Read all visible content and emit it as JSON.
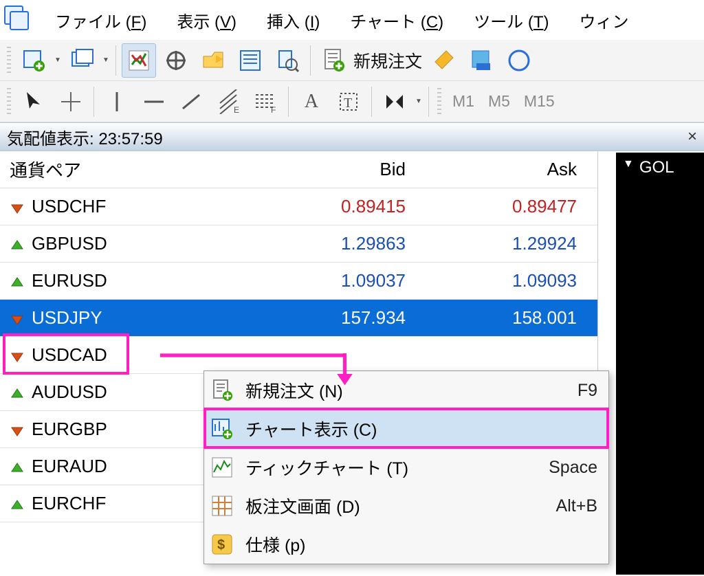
{
  "menu": {
    "items": [
      {
        "label": "ファイル",
        "key": "F"
      },
      {
        "label": "表示",
        "key": "V"
      },
      {
        "label": "挿入",
        "key": "I"
      },
      {
        "label": "チャート",
        "key": "C"
      },
      {
        "label": "ツール",
        "key": "T"
      },
      {
        "label": "ウィン",
        "key": ""
      }
    ]
  },
  "toolbar1": {
    "new_order_label": "新規注文"
  },
  "toolbar2": {
    "timeframes": [
      "M1",
      "M5",
      "M15"
    ]
  },
  "market_watch": {
    "title": "気配値表示: 23:57:59",
    "headers": {
      "symbol": "通貨ペア",
      "bid": "Bid",
      "ask": "Ask"
    },
    "rows": [
      {
        "symbol": "USDCHF",
        "bid": "0.89415",
        "ask": "0.89477",
        "dir": "down",
        "color": "down"
      },
      {
        "symbol": "GBPUSD",
        "bid": "1.29863",
        "ask": "1.29924",
        "dir": "up",
        "color": "up"
      },
      {
        "symbol": "EURUSD",
        "bid": "1.09037",
        "ask": "1.09093",
        "dir": "up",
        "color": "up"
      },
      {
        "symbol": "USDJPY",
        "bid": "157.934",
        "ask": "158.001",
        "dir": "down",
        "color": "up",
        "selected": true
      },
      {
        "symbol": "USDCAD",
        "bid": "",
        "ask": "",
        "dir": "down"
      },
      {
        "symbol": "AUDUSD",
        "bid": "",
        "ask": "",
        "dir": "up"
      },
      {
        "symbol": "EURGBP",
        "bid": "",
        "ask": "",
        "dir": "down"
      },
      {
        "symbol": "EURAUD",
        "bid": "",
        "ask": "",
        "dir": "up"
      },
      {
        "symbol": "EURCHF",
        "bid": "",
        "ask": "",
        "dir": "up"
      }
    ]
  },
  "context_menu": {
    "items": [
      {
        "label": "新規注文 (N)",
        "shortcut": "F9",
        "icon": "doc-plus"
      },
      {
        "label": "チャート表示 (C)",
        "shortcut": "",
        "icon": "chart-plus",
        "hover": true
      },
      {
        "label": "ティックチャート (T)",
        "shortcut": "Space",
        "icon": "tick"
      },
      {
        "label": "板注文画面 (D)",
        "shortcut": "Alt+B",
        "icon": "grid"
      },
      {
        "label": "仕様 (p)",
        "shortcut": "",
        "icon": "dollar"
      }
    ]
  },
  "chart_tab": {
    "label": "GOL"
  }
}
